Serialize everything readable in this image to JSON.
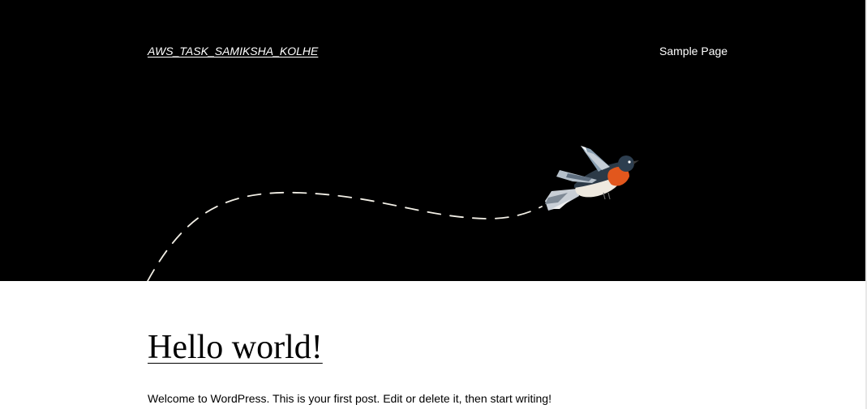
{
  "header": {
    "site_title": "AWS_TASK_SAMIKSHA_KOLHE",
    "nav": [
      {
        "label": "Sample Page"
      }
    ],
    "background_color": "#000000",
    "illustration": "flying-bird-with-dashed-flight-path-icon"
  },
  "post": {
    "title": "Hello world!",
    "excerpt": "Welcome to WordPress. This is your first post. Edit or delete it, then start writing!"
  }
}
